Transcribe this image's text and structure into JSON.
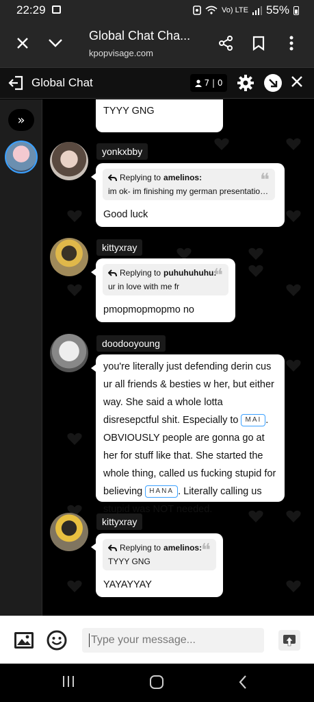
{
  "status_bar": {
    "time": "22:29",
    "network": "Vo) LTE",
    "battery": "55%"
  },
  "browser": {
    "title": "Global Chat Cha...",
    "url": "kpopvisage.com"
  },
  "chat_header": {
    "title": "Global Chat",
    "online_count": "7 | 0"
  },
  "messages": [
    {
      "text": "TYYY GNG"
    },
    {
      "username": "yonkxbby",
      "reply_to": "amelinos:",
      "reply_text": "im ok- im finishing my german presentation for t...",
      "text": "Good luck"
    },
    {
      "username": "kittyxray",
      "reply_to": "puhuhuhuhu:",
      "reply_text": "ur in love with me fr",
      "text": "pmopmopmopmo no"
    },
    {
      "username": "doodooyoung",
      "text_1": "you're literally just defending derin cus ur all friends & besties w her, but either way. She said a whole lotta disresepctful shit. Especially to",
      "mention_1": "MAI",
      "text_2": ". OBVIOUSLY people are gonna go at her for stuff like that. She started the whole thing, called us fucking stupid for believing",
      "mention_2": "HANA",
      "text_3": ". Literally calling us stupid was NOT needed."
    },
    {
      "username": "kittyxray",
      "reply_to": "amelinos:",
      "reply_text": "TYYY GNG",
      "text": "YAYAYYAY"
    }
  ],
  "reply_prefix": "Replying to",
  "input": {
    "placeholder": "Type your message..."
  }
}
